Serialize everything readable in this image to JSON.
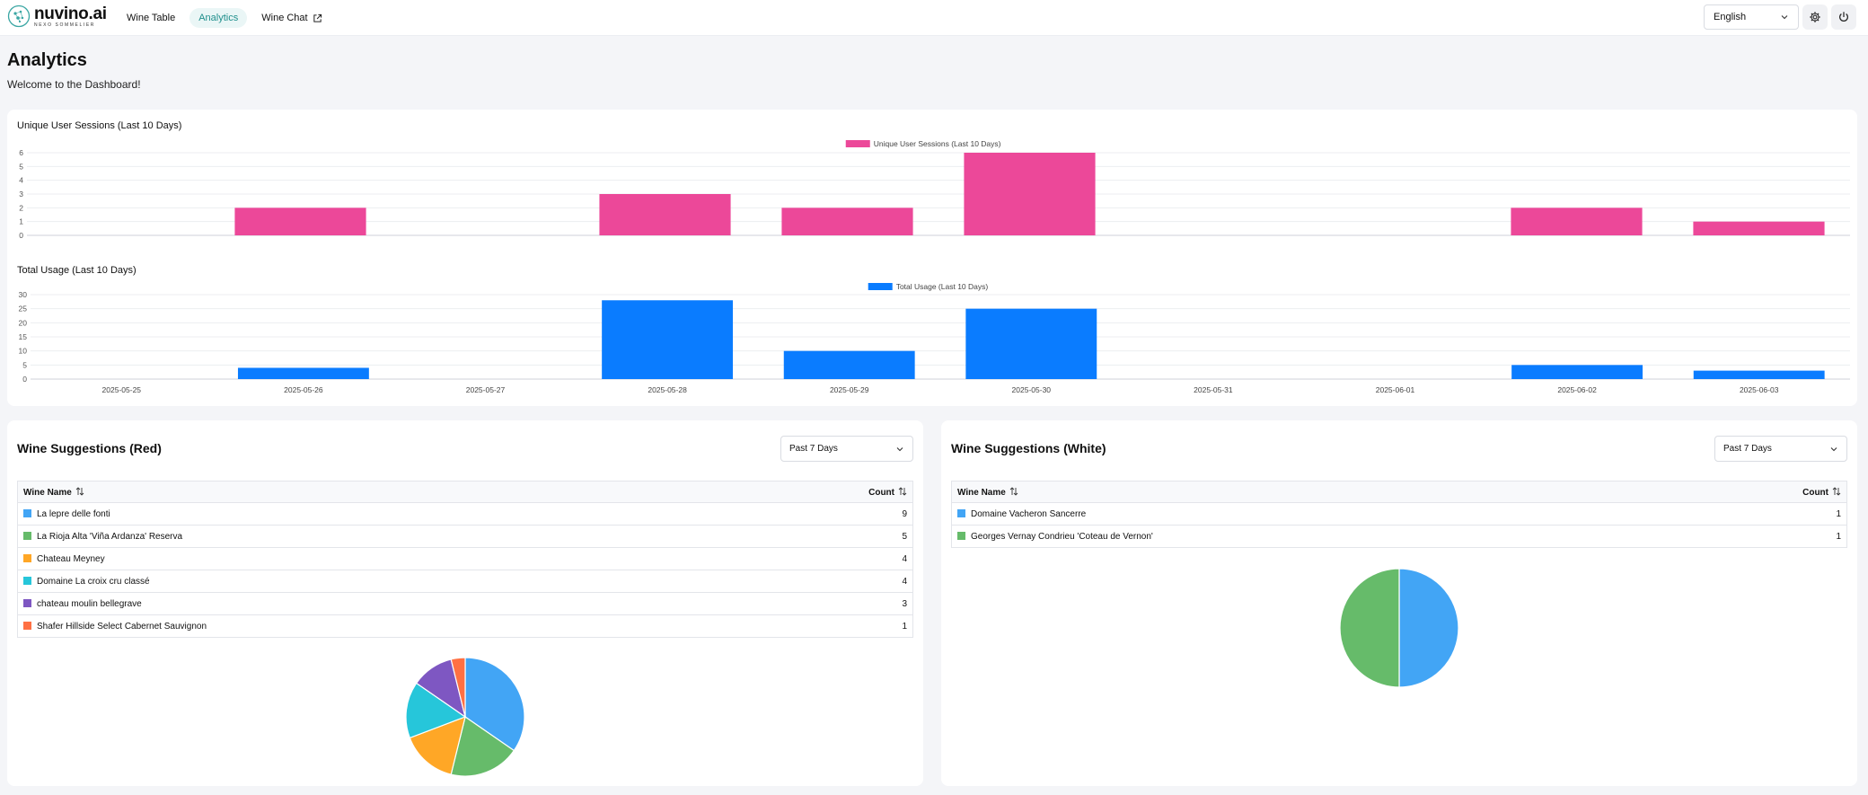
{
  "header": {
    "logo_name": "nuvino.ai",
    "logo_sub": "NEXO SOMMELIER",
    "nav": [
      {
        "label": "Wine Table",
        "active": false
      },
      {
        "label": "Analytics",
        "active": true
      },
      {
        "label": "Wine Chat",
        "active": false,
        "external": true
      }
    ],
    "language": "English"
  },
  "page": {
    "title": "Analytics",
    "subtitle": "Welcome to the Dashboard!"
  },
  "charts": {
    "sessions": {
      "title": "Unique User Sessions (Last 10 Days)",
      "legend": "Unique User Sessions (Last 10 Days)",
      "color": "#ec4899"
    },
    "usage": {
      "title": "Total Usage (Last 10 Days)",
      "legend": "Total Usage (Last 10 Days)",
      "color": "#0a7cff"
    }
  },
  "chart_data": [
    {
      "type": "bar",
      "title": "Unique User Sessions (Last 10 Days)",
      "categories": [
        "2025-05-25",
        "2025-05-26",
        "2025-05-27",
        "2025-05-28",
        "2025-05-29",
        "2025-05-30",
        "2025-05-31",
        "2025-06-01",
        "2025-06-02",
        "2025-06-03"
      ],
      "series": [
        {
          "name": "Unique User Sessions (Last 10 Days)",
          "values": [
            0,
            2,
            0,
            3,
            2,
            6,
            0,
            0,
            2,
            1
          ]
        }
      ],
      "yticks": [
        0,
        1,
        2,
        3,
        4,
        5,
        6
      ],
      "ylim": [
        0,
        6
      ],
      "legend": "top-center",
      "grid": true
    },
    {
      "type": "bar",
      "title": "Total Usage (Last 10 Days)",
      "categories": [
        "2025-05-25",
        "2025-05-26",
        "2025-05-27",
        "2025-05-28",
        "2025-05-29",
        "2025-05-30",
        "2025-05-31",
        "2025-06-01",
        "2025-06-02",
        "2025-06-03"
      ],
      "series": [
        {
          "name": "Total Usage (Last 10 Days)",
          "values": [
            0,
            4,
            0,
            28,
            10,
            25,
            0,
            0,
            5,
            3
          ]
        }
      ],
      "yticks": [
        0,
        5,
        10,
        15,
        20,
        25,
        30
      ],
      "ylim": [
        0,
        30
      ],
      "legend": "top-center",
      "grid": true
    },
    {
      "type": "pie",
      "title": "Wine Suggestions (Red)",
      "labels": [
        "La lepre delle fonti",
        "La Rioja Alta 'Viña Ardanza' Reserva",
        "Chateau Meyney",
        "Domaine La croix cru classé",
        "chateau moulin bellegrave",
        "Shafer Hillside Select Cabernet Sauvignon"
      ],
      "values": [
        9,
        5,
        4,
        4,
        3,
        1
      ],
      "colors": [
        "#42a5f5",
        "#66bb6a",
        "#ffa726",
        "#26c6da",
        "#7e57c2",
        "#ff7043"
      ]
    },
    {
      "type": "pie",
      "title": "Wine Suggestions (White)",
      "labels": [
        "Domaine Vacheron Sancerre",
        "Georges Vernay Condrieu 'Coteau de Vernon'"
      ],
      "values": [
        1,
        1
      ],
      "colors": [
        "#42a5f5",
        "#66bb6a"
      ]
    }
  ],
  "red": {
    "title": "Wine Suggestions (Red)",
    "period": "Past 7 Days",
    "col_name": "Wine Name",
    "col_count": "Count",
    "rows": [
      {
        "name": "La lepre delle fonti",
        "count": "9",
        "color": "#42a5f5"
      },
      {
        "name": "La Rioja Alta 'Viña Ardanza' Reserva",
        "count": "5",
        "color": "#66bb6a"
      },
      {
        "name": "Chateau Meyney",
        "count": "4",
        "color": "#ffa726"
      },
      {
        "name": "Domaine La croix cru classé",
        "count": "4",
        "color": "#26c6da"
      },
      {
        "name": "chateau moulin bellegrave",
        "count": "3",
        "color": "#7e57c2"
      },
      {
        "name": "Shafer Hillside Select Cabernet Sauvignon",
        "count": "1",
        "color": "#ff7043"
      }
    ]
  },
  "white": {
    "title": "Wine Suggestions (White)",
    "period": "Past 7 Days",
    "col_name": "Wine Name",
    "col_count": "Count",
    "rows": [
      {
        "name": "Domaine Vacheron Sancerre",
        "count": "1",
        "color": "#42a5f5"
      },
      {
        "name": "Georges Vernay Condrieu 'Coteau de Vernon'",
        "count": "1",
        "color": "#66bb6a"
      }
    ]
  }
}
